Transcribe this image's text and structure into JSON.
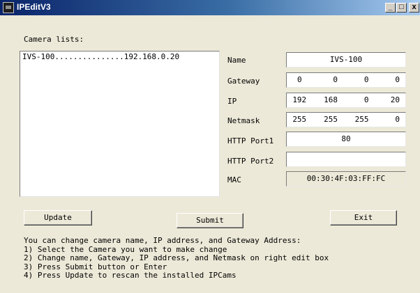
{
  "window": {
    "title": "IPEditV3",
    "controls": {
      "minimize": "_",
      "maximize": "□",
      "close": "x"
    }
  },
  "camera_list": {
    "label": "Camera lists:",
    "items": [
      "IVS-100...............192.168.0.20"
    ]
  },
  "fields": {
    "name": {
      "label": "Name",
      "value": "IVS-100"
    },
    "gateway": {
      "label": "Gateway",
      "octets": [
        "0",
        "0",
        "0",
        "0"
      ]
    },
    "ip": {
      "label": "IP",
      "octets": [
        "192",
        "168",
        "0",
        "20"
      ]
    },
    "netmask": {
      "label": "Netmask",
      "octets": [
        "255",
        "255",
        "255",
        "0"
      ]
    },
    "http_port1": {
      "label": "HTTP Port1",
      "value": "80"
    },
    "http_port2": {
      "label": "HTTP Port2",
      "value": ""
    },
    "mac": {
      "label": "MAC",
      "value": "00:30:4F:03:FF:FC"
    }
  },
  "buttons": {
    "update": "Update",
    "submit": "Submit",
    "exit": "Exit"
  },
  "help": {
    "line0": "You can change camera name, IP address, and Gateway Address:",
    "line1": "1) Select the Camera you want to make change",
    "line2": "2) Change name, Gateway, IP address, and Netmask on right edit box",
    "line3": "3) Press Submit button or Enter",
    "line4": "4) Press Update to rescan the installed IPCams"
  }
}
